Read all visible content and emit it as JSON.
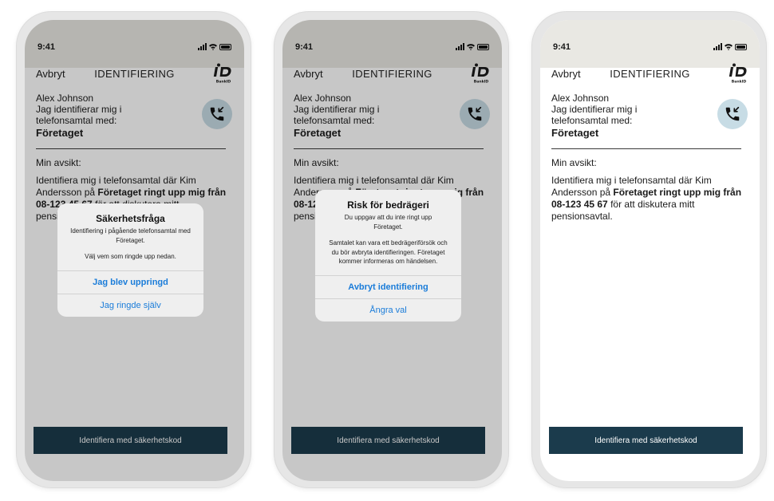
{
  "status_time": "9:41",
  "nav": {
    "cancel": "Avbryt",
    "title": "IDENTIFIERING",
    "logo_text": "BankID"
  },
  "identity": {
    "name": "Alex Johnson",
    "intro": "Jag identifierar mig i telefonsamtal med:",
    "company": "Företaget"
  },
  "intent": {
    "label": "Min avsikt:",
    "text_start": "Identifiera mig i telefonsamtal där Kim Andersson på ",
    "text_bold": "Företaget ringt upp mig från 08-123 45 67",
    "text_end": " för att diskutera mitt pensionsavtal."
  },
  "code_button": "Identifiera med säkerhetskod",
  "alert_security": {
    "title": "Säkerhetsfråga",
    "message": "Identifiering i pågående telefonsamtal med Företaget.",
    "message2": "Välj vem som ringde upp nedan.",
    "action_primary": "Jag blev uppringd",
    "action_secondary": "Jag ringde själv"
  },
  "alert_fraud": {
    "title": "Risk för bedrägeri",
    "message": "Du uppgav att du inte ringt upp Företaget.",
    "message2": "Samtalet kan vara ett bedrägeriförsök och du bör avbryta identifieringen. Företaget kommer informeras om händelsen.",
    "action_primary": "Avbryt identifiering",
    "action_secondary": "Ångra val"
  },
  "colors": {
    "button_bg": "#1b3b4c",
    "link": "#1a7cd9",
    "call_circle": "#c7dce5",
    "dim_overlay": "rgba(0,0,0,0.22)"
  },
  "icons": [
    "cellular-signal-icon",
    "wifi-icon",
    "battery-icon",
    "bankid-logo-icon",
    "incoming-call-icon"
  ]
}
